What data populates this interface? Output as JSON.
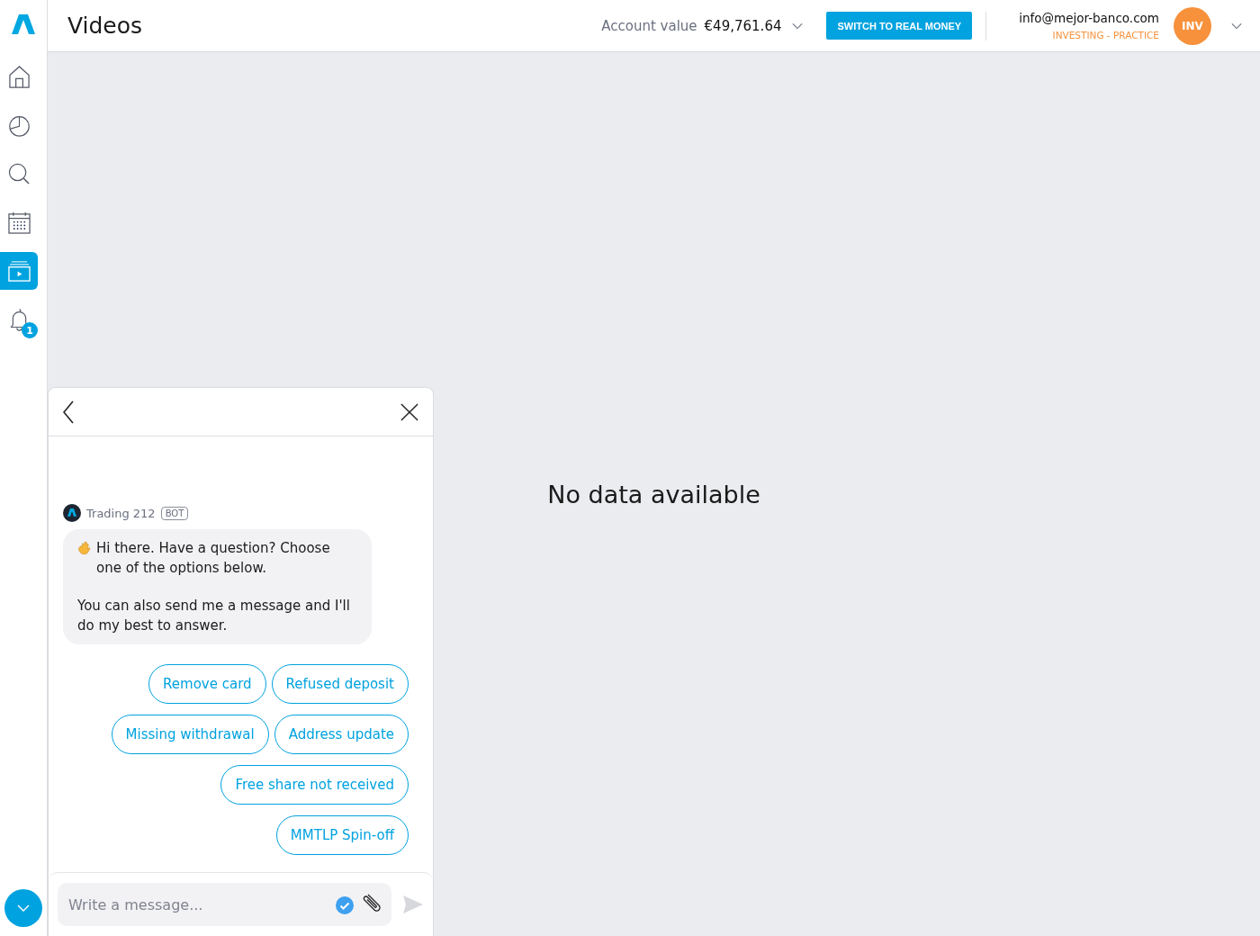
{
  "header": {
    "title": "Videos",
    "account_label": "Account value",
    "account_value": "€49,761.64",
    "switch_button": "SWITCH TO REAL MONEY",
    "email": "info@mejor-banco.com",
    "account_type": "INVESTING - PRACTICE",
    "avatar": "INV"
  },
  "sidebar": {
    "items": [
      {
        "kind": "home",
        "selected": false
      },
      {
        "kind": "portfolio",
        "selected": false
      },
      {
        "kind": "search",
        "selected": false
      },
      {
        "kind": "calendar",
        "selected": false
      },
      {
        "kind": "videos",
        "selected": true
      },
      {
        "kind": "notifications",
        "selected": false,
        "badge": "1"
      }
    ]
  },
  "main": {
    "empty_message": "No data available"
  },
  "chat": {
    "sender": "Trading 212",
    "sender_tag": "BOT",
    "message": [
      "Hi there. Have a question? Choose one of the options below.",
      "You can also send me a message and I'll do my best to answer."
    ],
    "quick_replies": [
      [
        "Remove card",
        "Refused deposit"
      ],
      [
        "Missing withdrawal",
        "Address update"
      ],
      [
        "Free share not received"
      ],
      [
        "MMTLP Spin-off"
      ]
    ],
    "input": {
      "placeholder": "Write a message..."
    }
  }
}
